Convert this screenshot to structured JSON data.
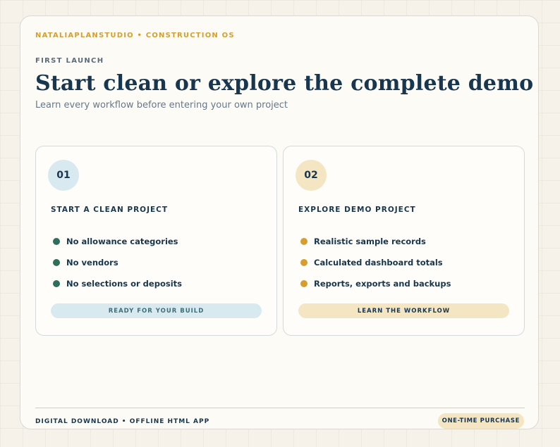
{
  "brand": "NATALIAPLANSTUDIO • CONSTRUCTION OS",
  "eyebrow": "FIRST LAUNCH",
  "title": "Start clean or explore the complete demo",
  "subtitle": "Learn every workflow before entering your own project",
  "cards": [
    {
      "number": "01",
      "title": "START A CLEAN PROJECT",
      "items": [
        "No allowance categories",
        "No vendors",
        "No selections or deposits"
      ],
      "button": "READY FOR YOUR BUILD"
    },
    {
      "number": "02",
      "title": "EXPLORE DEMO PROJECT",
      "items": [
        "Realistic sample records",
        "Calculated dashboard totals",
        "Reports, exports and backups"
      ],
      "button": "LEARN THE WORKFLOW"
    }
  ],
  "footer": {
    "left": "DIGITAL DOWNLOAD • OFFLINE HTML APP",
    "badge": "ONE-TIME PURCHASE"
  },
  "colors": {
    "accent": "#d69e2e",
    "navy": "#17364f",
    "green": "#2f6e5a",
    "blue_tint": "#d9e9f0",
    "gold_tint": "#f5e6c3"
  }
}
